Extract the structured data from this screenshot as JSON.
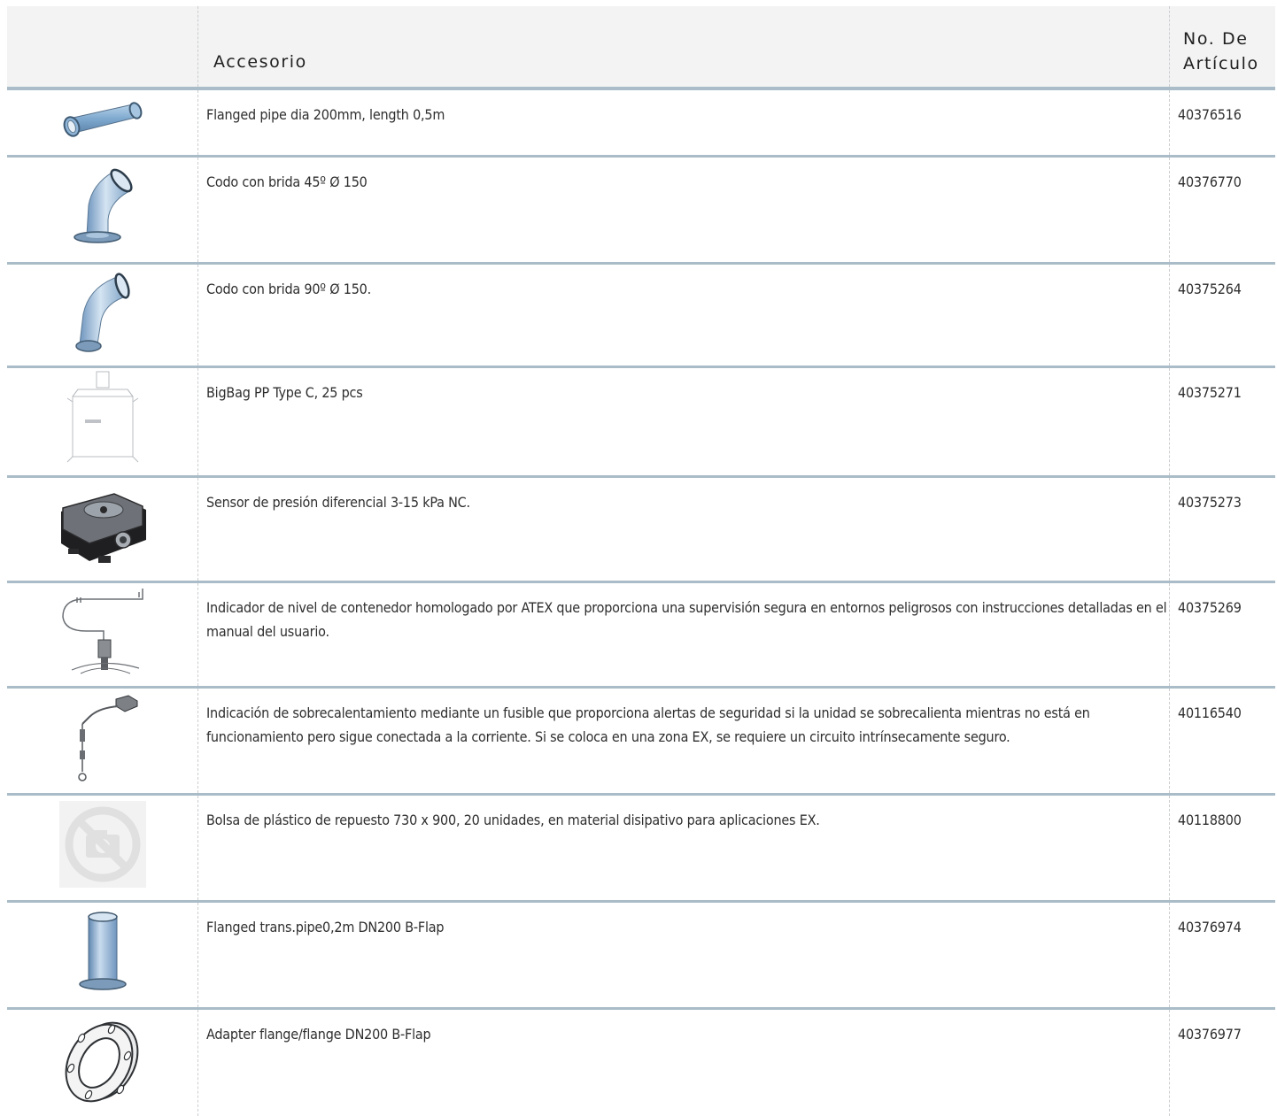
{
  "table": {
    "headers": {
      "image": "",
      "accessory": "Accesorio",
      "article_number_line1": "No. De",
      "article_number_line2": "Artículo"
    },
    "rows": [
      {
        "description": "Flanged pipe dia 200mm, length 0,5m",
        "article_number": "40376516",
        "icon": "flanged-pipe-icon"
      },
      {
        "description": "Codo con brida 45º Ø 150",
        "article_number": "40376770",
        "icon": "elbow-45-icon"
      },
      {
        "description": "Codo con brida 90º Ø 150.",
        "article_number": "40375264",
        "icon": "elbow-90-icon"
      },
      {
        "description": "BigBag PP Type C, 25 pcs",
        "article_number": "40375271",
        "icon": "bigbag-icon"
      },
      {
        "description": "Sensor de presión diferencial 3-15 kPa NC.",
        "article_number": "40375273",
        "icon": "pressure-sensor-icon"
      },
      {
        "description": "Indicador de nivel de contenedor homologado por ATEX que proporciona una supervisión segura en entornos peligrosos con instrucciones detalladas en el manual del usuario.",
        "article_number": "40375269",
        "icon": "level-indicator-icon"
      },
      {
        "description": "Indicación de sobrecalentamiento mediante un fusible que proporciona alertas de seguridad si la unidad se sobrecalienta mientras no está en funcionamiento pero sigue conectada a la corriente. Si se coloca en una zona EX, se requiere un circuito intrínsecamente seguro.",
        "article_number": "40116540",
        "icon": "fuse-indicator-icon"
      },
      {
        "description": "Bolsa de plástico de repuesto 730 x 900, 20 unidades, en material disipativo para aplicaciones EX.",
        "article_number": "40118800",
        "icon": "no-image-icon"
      },
      {
        "description": "Flanged trans.pipe0,2m DN200 B-Flap",
        "article_number": "40376974",
        "icon": "transition-pipe-icon"
      },
      {
        "description": "Adapter flange/flange DN200 B-Flap",
        "article_number": "40376977",
        "icon": "adapter-flange-icon"
      }
    ]
  }
}
